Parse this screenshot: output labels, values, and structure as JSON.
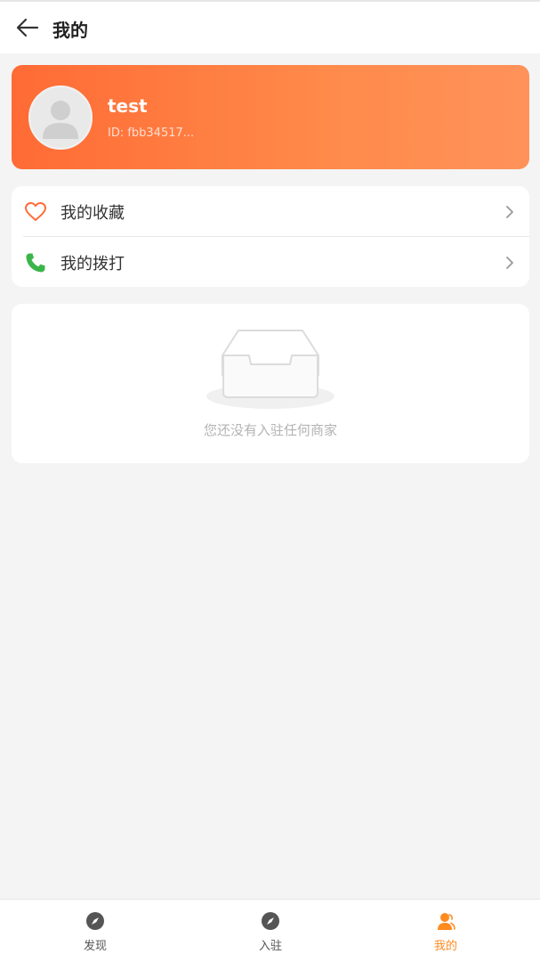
{
  "header": {
    "title": "我的"
  },
  "profile": {
    "name": "test",
    "id_text": "ID: fbb34517..."
  },
  "menu": [
    {
      "label": "我的收藏",
      "icon": "heart-icon"
    },
    {
      "label": "我的拨打",
      "icon": "phone-icon"
    }
  ],
  "empty_state": {
    "text": "您还没有入驻任何商家"
  },
  "tabbar": {
    "tabs": [
      {
        "label": "发现",
        "icon": "compass-icon",
        "active": false
      },
      {
        "label": "入驻",
        "icon": "compass-icon",
        "active": false
      },
      {
        "label": "我的",
        "icon": "user-icon",
        "active": true
      }
    ]
  },
  "colors": {
    "accent": "#ff6b35",
    "accent_light": "#ff925a",
    "tab_active": "#ff8a1e",
    "phone_green": "#3bb54a"
  }
}
